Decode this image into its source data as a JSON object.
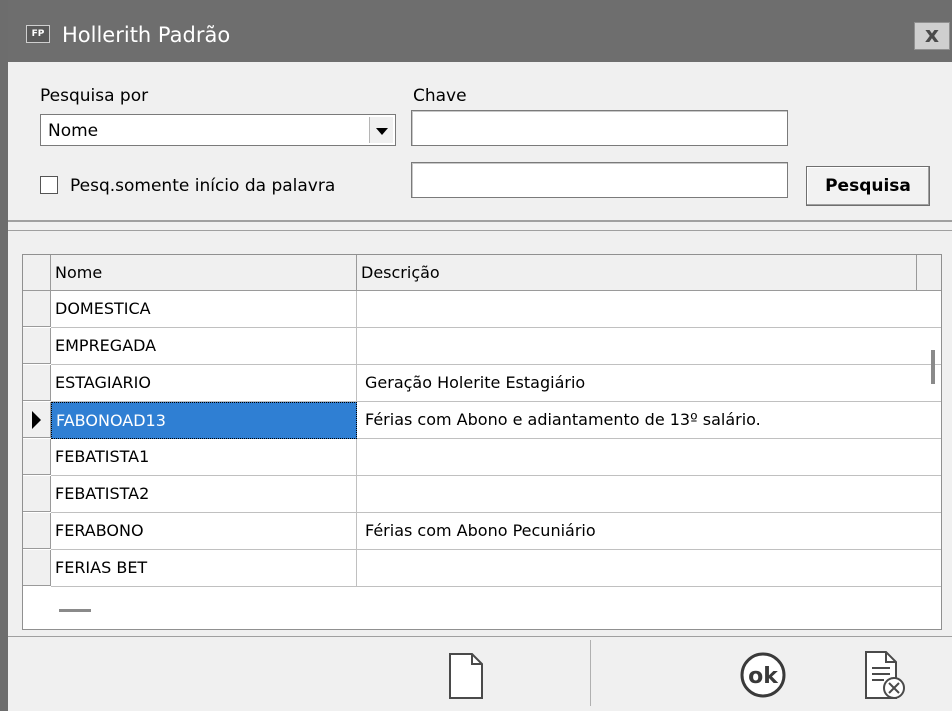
{
  "window": {
    "icon_text": "FP",
    "title": "Hollerith Padrão",
    "close_glyph": "x"
  },
  "search": {
    "pesquisa_por_label": "Pesquisa por",
    "pesquisa_por_value": "Nome",
    "chave_label": "Chave",
    "chave_value": "",
    "second_value": "",
    "checkbox_label": "Pesq.somente início da palavra",
    "checkbox_checked": false,
    "pesquisa_button": "Pesquisa"
  },
  "grid": {
    "columns": [
      "Nome",
      "Descrição"
    ],
    "rows": [
      {
        "nome": "DOMESTICA",
        "descricao": ""
      },
      {
        "nome": "EMPREGADA",
        "descricao": ""
      },
      {
        "nome": "ESTAGIARIO",
        "descricao": "Geração Holerite Estagiário"
      },
      {
        "nome": "FABONOAD13",
        "descricao": "Férias com Abono e adiantamento de 13º salário."
      },
      {
        "nome": "FEBATISTA1",
        "descricao": ""
      },
      {
        "nome": "FEBATISTA2",
        "descricao": ""
      },
      {
        "nome": "FERABONO",
        "descricao": "Férias com Abono Pecuniário"
      },
      {
        "nome": "FERIAS BET",
        "descricao": ""
      }
    ],
    "selected_row": 3,
    "selection_color": "#2f7fd3"
  },
  "toolbar": {
    "new_icon": "new-document-icon",
    "ok_icon": "ok-icon",
    "ok_text": "ok",
    "cancel_icon": "document-cancel-icon"
  }
}
